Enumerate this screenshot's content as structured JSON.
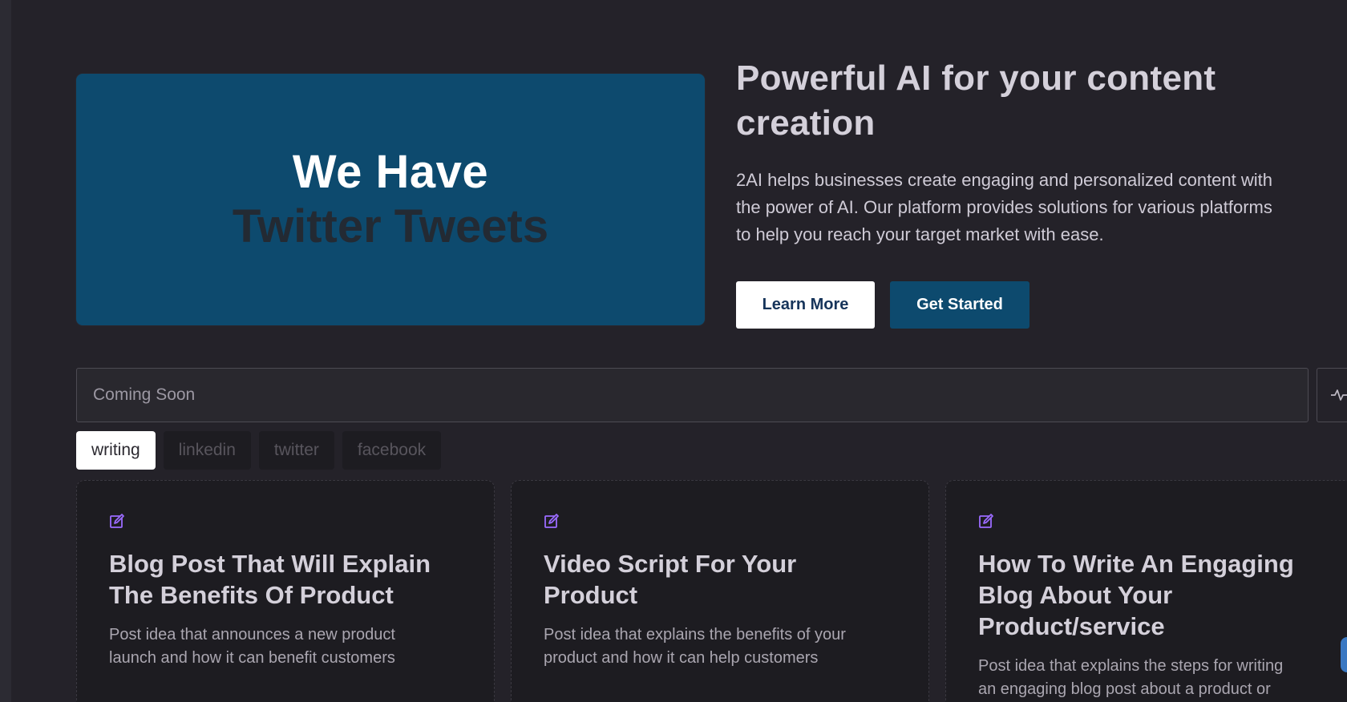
{
  "banner": {
    "line1": "We Have",
    "line2": "Twitter Tweets"
  },
  "hero": {
    "title": "Powerful AI for your content creation",
    "description_lines": [
      "2AI helps businesses create engaging and personalized content with",
      "the power of AI. Our platform provides solutions for various platforms",
      "to help you reach your target market with ease."
    ],
    "learn_more_label": "Learn More",
    "get_started_label": "Get Started"
  },
  "search": {
    "placeholder": "Coming Soon",
    "value": ""
  },
  "tabs": [
    {
      "label": "writing",
      "active": true
    },
    {
      "label": "linkedin",
      "active": false
    },
    {
      "label": "twitter",
      "active": false
    },
    {
      "label": "facebook",
      "active": false
    }
  ],
  "cards": [
    {
      "icon": "edit-icon",
      "title": "Blog Post That Will Explain The Benefits Of Product",
      "description_lines": [
        "Post idea that announces a new product",
        "launch and how it can benefit customers"
      ]
    },
    {
      "icon": "edit-icon",
      "title": "Video Script For Your Product",
      "description_lines": [
        "Post idea that explains the benefits of your",
        "product and how it can help customers"
      ]
    },
    {
      "icon": "edit-icon",
      "title": "How To Write An Engaging Blog About Your Product/service",
      "description_lines": [
        "Post idea that explains the steps for writing",
        "an engaging blog post about a product or"
      ]
    }
  ],
  "icons": {
    "search_action": "pulse-icon",
    "card": "edit-icon"
  },
  "colors": {
    "background": "#242229",
    "brand": "#0d4a6e",
    "card": "#1d1c21",
    "accent_icon": "#9b6bff"
  }
}
